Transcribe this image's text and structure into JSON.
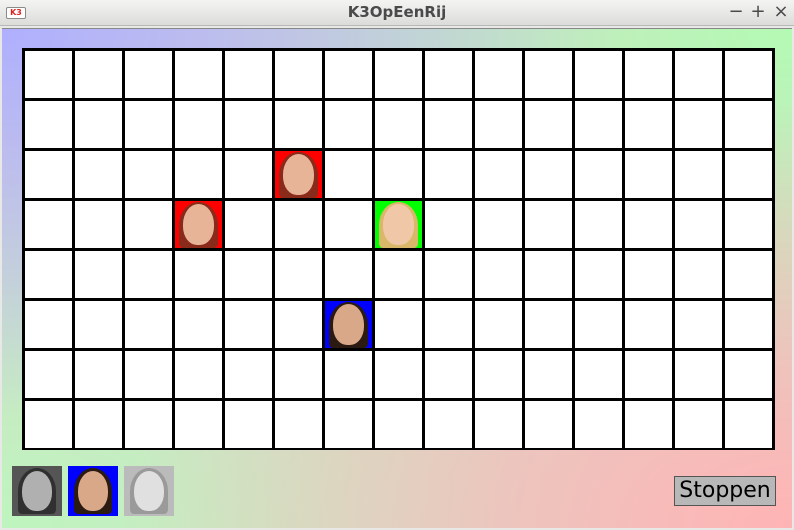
{
  "window": {
    "title": "K3OpEenRij",
    "icon_label": "K3"
  },
  "controls": {
    "minimize": "−",
    "maximize": "+",
    "close": "×"
  },
  "board": {
    "columns": 15,
    "rows": 8,
    "pieces": [
      {
        "row": 2,
        "col": 5,
        "player": "red"
      },
      {
        "row": 3,
        "col": 3,
        "player": "red"
      },
      {
        "row": 3,
        "col": 7,
        "player": "green"
      },
      {
        "row": 5,
        "col": 6,
        "player": "blue"
      }
    ]
  },
  "players": {
    "red": {
      "bg": "#ff0000",
      "hair": "#8a2a1a",
      "skin": "#e8b498"
    },
    "green": {
      "bg": "#00ff00",
      "hair": "#d9b86a",
      "skin": "#f0c8a8"
    },
    "blue": {
      "bg": "#0000ff",
      "hair": "#2a1a12",
      "skin": "#d8a888"
    }
  },
  "selector": [
    {
      "name": "red-singer",
      "bg": "#555555",
      "hair": "#303030",
      "skin": "#b0b0b0",
      "active": false
    },
    {
      "name": "blue-singer",
      "bg": "#0000ff",
      "hair": "#2a1a12",
      "skin": "#d8a888",
      "active": true
    },
    {
      "name": "blond-singer",
      "bg": "#bbbbbb",
      "hair": "#9a9a9a",
      "skin": "#e0e0e0",
      "active": false
    }
  ],
  "buttons": {
    "stop_label": "Stoppen"
  }
}
